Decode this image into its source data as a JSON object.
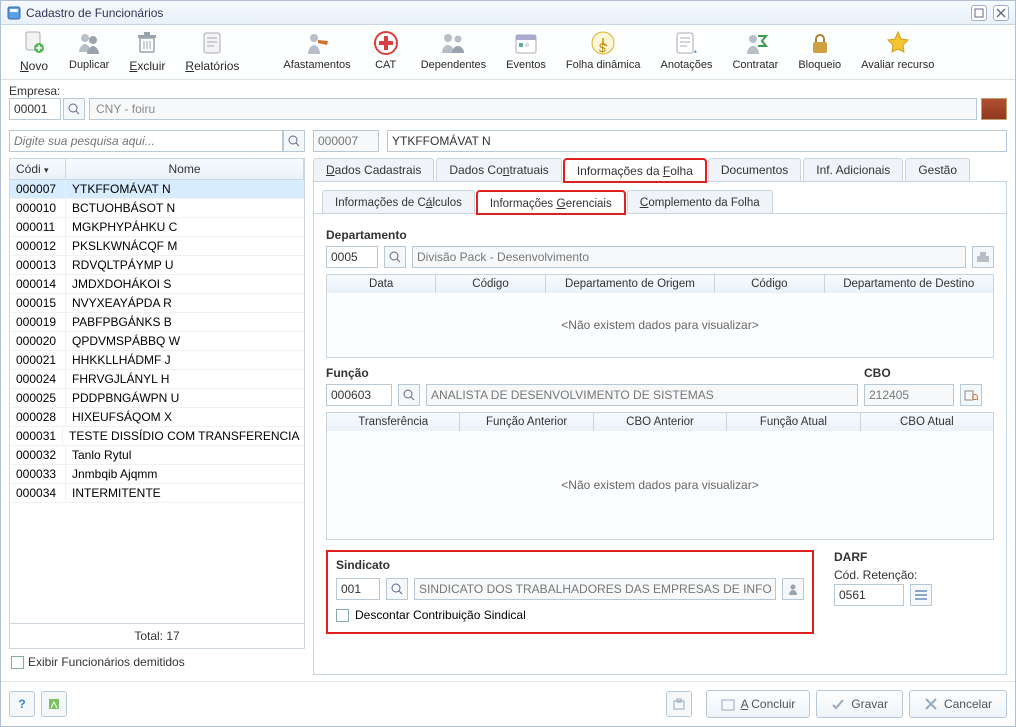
{
  "window": {
    "title": "Cadastro de Funcionários"
  },
  "toolbar": {
    "novo": "Novo",
    "duplicar": "Duplicar",
    "excluir": "Excluir",
    "relatorios": "Relatórios",
    "afastamentos": "Afastamentos",
    "cat": "CAT",
    "dependentes": "Dependentes",
    "eventos": "Eventos",
    "folha": "Folha dinâmica",
    "anotacoes": "Anotações",
    "contratar": "Contratar",
    "bloqueio": "Bloqueio",
    "avaliar": "Avaliar recurso"
  },
  "empresa": {
    "label": "Empresa:",
    "code": "00001",
    "name": "CNY - foiru"
  },
  "search": {
    "placeholder": "Digite sua pesquisa aqui..."
  },
  "grid": {
    "col_codigo": "Códi",
    "col_nome": "Nome",
    "rows": [
      {
        "codigo": "000007",
        "nome": "YTKFFOMÁVAT N"
      },
      {
        "codigo": "000010",
        "nome": "BCTUOHBÁSOT N"
      },
      {
        "codigo": "000011",
        "nome": "MGKPHYPÁHKU C"
      },
      {
        "codigo": "000012",
        "nome": "PKSLKWNÁCQF M"
      },
      {
        "codigo": "000013",
        "nome": "RDVQLTPÁYMP U"
      },
      {
        "codigo": "000014",
        "nome": "JMDXDOHÁKOI S"
      },
      {
        "codigo": "000015",
        "nome": "NVYXEAYÁPDA R"
      },
      {
        "codigo": "000019",
        "nome": "PABFPBGÁNKS B"
      },
      {
        "codigo": "000020",
        "nome": "QPDVMSPÁBBQ W"
      },
      {
        "codigo": "000021",
        "nome": "HHKKLLHÁDMF J"
      },
      {
        "codigo": "000024",
        "nome": "FHRVGJLÁNYL H"
      },
      {
        "codigo": "000025",
        "nome": "PDDPBNGÁWPN U"
      },
      {
        "codigo": "000028",
        "nome": "HIXEUFSÁQOM X"
      },
      {
        "codigo": "000031",
        "nome": "TESTE DISSÍDIO COM TRANSFERENCIA"
      },
      {
        "codigo": "000032",
        "nome": "Tanlo Rytul"
      },
      {
        "codigo": "000033",
        "nome": "Jnmbqib Ajqmm"
      },
      {
        "codigo": "000034",
        "nome": "INTERMITENTE"
      }
    ],
    "total_label": "Total: 17",
    "exibir_demitidos": "Exibir Funcionários demitidos"
  },
  "detail": {
    "code": "000007",
    "name": "YTKFFOMÁVAT N",
    "tabs": {
      "dc": "Dados Cadastrais",
      "dco": "Dados Contratuais",
      "if": "Informações da Folha",
      "doc": "Documentos",
      "ia": "Inf. Adicionais",
      "ges": "Gestão"
    },
    "subtabs": {
      "calc": "Informações de Cálculos",
      "ger": "Informações Gerenciais",
      "comp": "Complemento da Folha"
    },
    "departamento": {
      "title": "Departamento",
      "code": "0005",
      "desc": "Divisão Pack - Desenvolvimento",
      "cols": {
        "data": "Data",
        "cod": "Código",
        "orig": "Departamento de Origem",
        "cod2": "Código",
        "dest": "Departamento de Destino"
      },
      "empty": "<Não existem dados para visualizar>"
    },
    "funcao": {
      "title": "Função",
      "code": "000603",
      "desc": "ANALISTA DE DESENVOLVIMENTO DE SISTEMAS",
      "cbo_label": "CBO",
      "cbo": "212405",
      "cols": {
        "transf": "Transferência",
        "fant": "Função Anterior",
        "cboant": "CBO Anterior",
        "fatu": "Função Atual",
        "cboatu": "CBO Atual"
      },
      "empty": "<Não existem dados para visualizar>"
    },
    "sindicato": {
      "title": "Sindicato",
      "code": "001",
      "desc": "SINDICATO DOS TRABALHADORES DAS EMPRESAS DE INFORMÁTIC",
      "descontar": "Descontar Contribuição Sindical"
    },
    "darf": {
      "title": "DARF",
      "label": "Cód. Retenção:",
      "code": "0561"
    }
  },
  "footer": {
    "concluir": "A Concluir",
    "gravar": "Gravar",
    "cancelar": "Cancelar"
  }
}
